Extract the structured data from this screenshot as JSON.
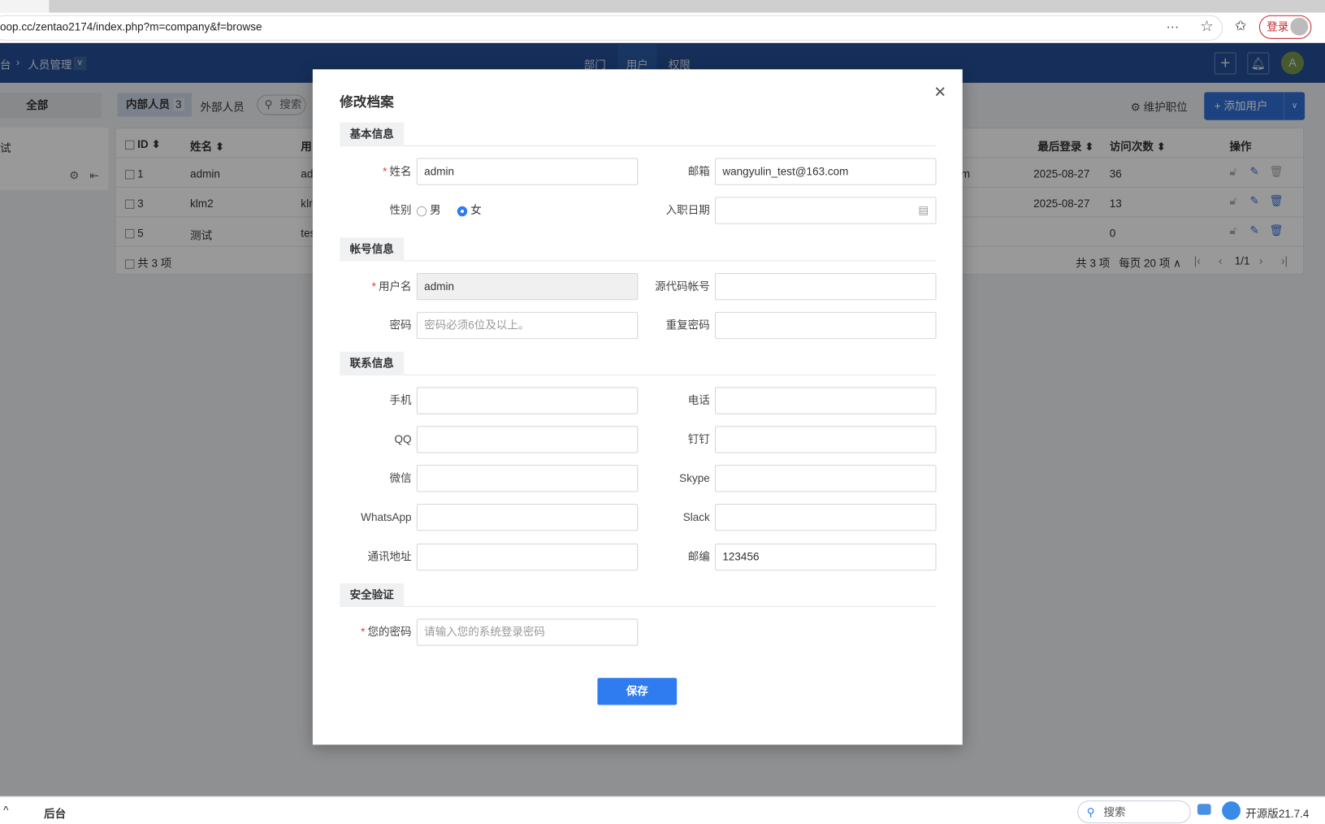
{
  "browser": {
    "url": "oop.cc/zentao2174/index.php?m=company&f=browse",
    "login_label": "登录"
  },
  "header": {
    "breadcrumb_root": "台",
    "breadcrumb_current": "人员管理",
    "nav": [
      "部门",
      "用户",
      "权限"
    ],
    "avatar": "A"
  },
  "toolbar": {
    "all": "全部",
    "internal": "内部人员",
    "internal_count": "3",
    "external": "外部人员",
    "search": "搜索",
    "maintain": "维护职位",
    "add_user": "添加用户"
  },
  "sidebar": {
    "item": "试"
  },
  "table": {
    "columns": [
      "ID",
      "姓名",
      "用",
      "最后登录",
      "访问次数",
      "操作"
    ],
    "rows": [
      {
        "id": "1",
        "name": "admin",
        "user": "ad",
        "email_tail": "m",
        "last": "2025-08-27",
        "visits": "36"
      },
      {
        "id": "3",
        "name": "klm2",
        "user": "klr",
        "email_tail": "",
        "last": "2025-08-27",
        "visits": "13"
      },
      {
        "id": "5",
        "name": "测试",
        "user": "tes",
        "email_tail": "",
        "last": "",
        "visits": "0"
      }
    ],
    "footer_total": "共 3 项",
    "pager": {
      "total": "共 3 项",
      "per_page": "每页 20 项",
      "page": "1/1"
    }
  },
  "modal": {
    "title": "修改档案",
    "sections": {
      "basic": "基本信息",
      "account": "帐号信息",
      "contact": "联系信息",
      "security": "安全验证"
    },
    "fields": {
      "realname": {
        "label": "姓名",
        "value": "admin"
      },
      "email": {
        "label": "邮箱",
        "value": "wangyulin_test@163.com"
      },
      "gender": {
        "label": "性别",
        "options": [
          "男",
          "女"
        ],
        "selected": "女"
      },
      "join": {
        "label": "入职日期",
        "value": ""
      },
      "account": {
        "label": "用户名",
        "value": "admin"
      },
      "commiter": {
        "label": "源代码帐号",
        "value": ""
      },
      "password": {
        "label": "密码",
        "placeholder": "密码必须6位及以上。"
      },
      "password2": {
        "label": "重复密码",
        "value": ""
      },
      "mobile": {
        "label": "手机",
        "value": ""
      },
      "phone": {
        "label": "电话",
        "value": ""
      },
      "qq": {
        "label": "QQ",
        "value": ""
      },
      "dingding": {
        "label": "钉钉",
        "value": ""
      },
      "weixin": {
        "label": "微信",
        "value": ""
      },
      "skype": {
        "label": "Skype",
        "value": ""
      },
      "whatsapp": {
        "label": "WhatsApp",
        "value": ""
      },
      "slack": {
        "label": "Slack",
        "value": ""
      },
      "address": {
        "label": "通讯地址",
        "value": ""
      },
      "zipcode": {
        "label": "邮编",
        "value": "123456"
      },
      "verify": {
        "label": "您的密码",
        "placeholder": "请输入您的系统登录密码"
      }
    },
    "save": "保存"
  },
  "bottom": {
    "label": "后台",
    "search": "搜索",
    "version": "开源版21.7.4"
  },
  "colors": {
    "header": "#234f96",
    "primary": "#2f7cf0",
    "required": "#e0413a"
  }
}
